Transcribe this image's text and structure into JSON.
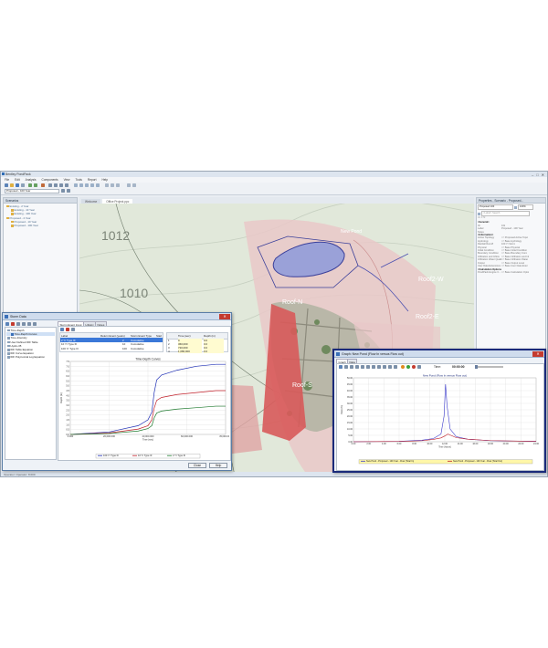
{
  "app": {
    "title": "Bentley PondPack",
    "menu": [
      "File",
      "Edit",
      "Analysis",
      "Components",
      "View",
      "Tools",
      "Report",
      "Help"
    ],
    "scenario": "Proposed - 100 Year",
    "window_buttons": [
      "–",
      "□",
      "✕"
    ]
  },
  "explorer": {
    "title": "Scenarios",
    "items": [
      {
        "label": "Existing - 2 Year",
        "indent": 0
      },
      {
        "label": "Existing - 10 Year",
        "indent": 1
      },
      {
        "label": "Existing - 100 Year",
        "indent": 1
      },
      {
        "label": "Proposed - 2 Year",
        "indent": 0
      },
      {
        "label": "Proposed - 10 Year",
        "indent": 1
      },
      {
        "label": "Proposed - 100 Year",
        "indent": 1
      }
    ]
  },
  "drawing": {
    "tabs": [
      "Welcome",
      "Office Project.ppc"
    ],
    "contours": [
      "1012",
      "1010"
    ],
    "catchments": [
      "Roof-N",
      "Roof-S",
      "Roof2-W",
      "Roof2-E"
    ],
    "pond_label": "New Pond"
  },
  "properties": {
    "title": "Properties - Scenario - Proposed...",
    "scenario": "Proposed 100",
    "zoom": "100%",
    "search": "<Label> Search",
    "header_id": "ID: 172",
    "rows": [
      {
        "label": "<General>",
        "sec": true
      },
      {
        "label": "ID",
        "value": "162"
      },
      {
        "label": "Label",
        "value": "Proposed - 100 Year"
      },
      {
        "label": "Notes",
        "value": ""
      },
      {
        "label": "<Information>",
        "sec": true
      },
      {
        "label": "Active Topology",
        "value": "<< Proposed Active Topol"
      },
      {
        "label": "Hydrology",
        "value": "<< Base Hydrology"
      },
      {
        "label": "Rainfall Runoff",
        "value": "100 Yr Storm"
      },
      {
        "label": "Physical",
        "value": "<< Base Physical"
      },
      {
        "label": "Initial Condition",
        "value": "<< Base Initial Condition"
      },
      {
        "label": "Boundary Condition",
        "value": "<< Base Boundary Cond"
      },
      {
        "label": "Infiltration and Inflow",
        "value": "<< Base Infiltration and Inf"
      },
      {
        "label": "Infiltration Water Quality",
        "value": "<< Base Infiltration Water"
      },
      {
        "label": "Output",
        "value": "<< Base Output Level"
      },
      {
        "label": "User Data Extensions",
        "value": "<< Base User Data Exten"
      },
      {
        "label": "<Calculation Options>",
        "sec": true
      },
      {
        "label": "PondPack Engine C...",
        "value": "<< Base Calculation Optio"
      }
    ]
  },
  "status_bar": "Operator: Operator: 8.000",
  "storm_dialog": {
    "title": "Storm Data",
    "tree": [
      {
        "label": "Time-Depth",
        "indent": 0
      },
      {
        "label": "Time-Depth Curves",
        "indent": 1,
        "selected": true
      },
      {
        "label": "Time-Intensity",
        "indent": 0
      },
      {
        "label": "User Defined IDF Table",
        "indent": 0
      },
      {
        "label": "Hydro-35",
        "indent": 0
      },
      {
        "label": "IDF Table Equation",
        "indent": 0
      },
      {
        "label": "IDF Curve Equation",
        "indent": 0
      },
      {
        "label": "IDF Polynomial Log Equation",
        "indent": 0
      }
    ],
    "tabs": [
      "Storm Event Input",
      "Library",
      "Notes"
    ],
    "table_headers": [
      "Label",
      "Return Event (years)",
      "Storm Event Type",
      "Start"
    ],
    "table_rows": [
      {
        "label": "2 Yr Type III",
        "ret": "2",
        "type": "Cumulative"
      },
      {
        "label": "10 Yr Type III",
        "ret": "10",
        "type": "Cumulative"
      },
      {
        "label": "100 Yr Type III",
        "ret": "100",
        "type": "Cumulative"
      }
    ],
    "td_headers": [
      "Time (sec)",
      "Depth (in)"
    ],
    "td_rows": [
      {
        "n": "1",
        "time": "0",
        "depth": "0.0"
      },
      {
        "n": "2",
        "time": "360,000",
        "depth": "0.0"
      },
      {
        "n": "3",
        "time": "720,000",
        "depth": "0.0"
      },
      {
        "n": "4",
        "time": "1,080,000",
        "depth": "0.0"
      }
    ],
    "buttons": {
      "close": "Close",
      "help": "Help"
    }
  },
  "hydro_dialog": {
    "title": "Graph: New Pond (Flow In versus Flow out)",
    "tabs": [
      "Graph",
      "Data"
    ],
    "time_label": "Time:",
    "time_value": "00:00:00"
  },
  "chart_data": [
    {
      "type": "line",
      "title": "Time-Depth Curves",
      "xlabel": "Time (sec)",
      "ylabel": "Depth (in)",
      "xlim": [
        0,
        80000
      ],
      "ylim": [
        0,
        7.5
      ],
      "xticks": [
        "0.000",
        "20,000.000",
        "40,000.000",
        "60,000.000",
        "80,000.000"
      ],
      "yticks": [
        "0.0",
        "0.5",
        "1.0",
        "1.5",
        "2.0",
        "2.5",
        "3.0",
        "3.5",
        "4.0",
        "4.5",
        "5.0",
        "5.5",
        "6.0",
        "6.5",
        "7.0",
        "7.5"
      ],
      "grid": true,
      "legend_position": "bottom",
      "series": [
        {
          "name": "100 Yr Type III",
          "color": "#1f2fb5",
          "x": [
            0,
            20000,
            35000,
            40000,
            42000,
            43200,
            44500,
            47000,
            55000,
            65000,
            75000,
            80000
          ],
          "y": [
            0,
            0.25,
            0.9,
            1.5,
            2.3,
            4.3,
            5.6,
            6.1,
            6.6,
            7.0,
            7.2,
            7.2
          ]
        },
        {
          "name": "10 Yr Type III",
          "color": "#c0202a",
          "x": [
            0,
            20000,
            35000,
            40000,
            42000,
            43200,
            44500,
            47000,
            55000,
            65000,
            75000,
            80000
          ],
          "y": [
            0,
            0.15,
            0.55,
            0.9,
            1.5,
            2.7,
            3.5,
            3.8,
            4.1,
            4.3,
            4.5,
            4.5
          ]
        },
        {
          "name": "2 Yr Type III",
          "color": "#1e7a2e",
          "x": [
            0,
            20000,
            35000,
            40000,
            42000,
            43200,
            44500,
            47000,
            55000,
            65000,
            75000,
            80000
          ],
          "y": [
            0,
            0.1,
            0.35,
            0.6,
            0.9,
            1.7,
            2.2,
            2.4,
            2.6,
            2.75,
            2.9,
            2.9
          ]
        }
      ]
    },
    {
      "type": "line",
      "title": "New Pond (Flow In versus Flow out)",
      "xlabel": "Time (hours)",
      "ylabel": "Flow (cfs)",
      "xlim": [
        0,
        24
      ],
      "ylim": [
        0,
        50
      ],
      "xticks": [
        "0.00",
        "2.00",
        "4.00",
        "6.00",
        "8.00",
        "10.00",
        "12.00",
        "14.00",
        "16.00",
        "18.00",
        "20.00",
        "22.00",
        "24.00"
      ],
      "yticks": [
        "0.00",
        "5.00",
        "10.00",
        "15.00",
        "20.00",
        "25.00",
        "30.00",
        "35.00",
        "40.00",
        "45.00",
        "50.00"
      ],
      "grid": true,
      "legend_position": "bottom",
      "series": [
        {
          "name": "New Pond - Proposed - 100 Year - Flow (Total In)",
          "color": "#3a3acc",
          "x": [
            0,
            6,
            9,
            10.5,
            11.5,
            11.9,
            12.1,
            12.3,
            12.7,
            13.5,
            15,
            18,
            24
          ],
          "y": [
            0,
            0.3,
            1.2,
            2.5,
            6,
            20,
            45,
            28,
            10,
            4,
            2,
            0.8,
            0.3
          ]
        },
        {
          "name": "New Pond - Proposed - 100 Year - Flow (Total Out)",
          "color": "#c0202a",
          "x": [
            0,
            6,
            9,
            10.5,
            11.5,
            12,
            12.4,
            12.8,
            13.5,
            15,
            18,
            24
          ],
          "y": [
            0,
            0.2,
            0.8,
            1.8,
            3,
            4.5,
            6,
            5,
            3.2,
            2,
            0.9,
            0.3
          ]
        }
      ]
    }
  ]
}
